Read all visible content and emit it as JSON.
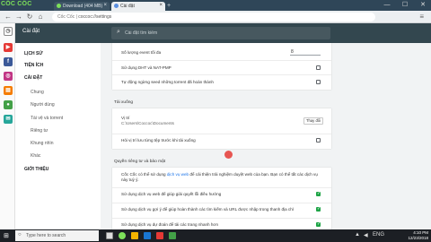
{
  "browser": {
    "logo_text": "CỐC CỐC",
    "tabs": [
      {
        "label": "Download (404 MB)",
        "active": false
      },
      {
        "label": "Cài đặt",
        "active": true
      }
    ],
    "new_tab_icon": "plus-icon",
    "address": {
      "prefix": "Cốc Cốc",
      "path": "coccoc://settings"
    }
  },
  "settings": {
    "title": "Cài đặt",
    "search_placeholder": "Cài đặt tìm kiếm"
  },
  "nav": {
    "items": [
      {
        "label": "LỊCH SỬ",
        "type": "section"
      },
      {
        "label": "TIỆN ÍCH",
        "type": "section"
      },
      {
        "label": "CÀI ĐẶT",
        "type": "section"
      },
      {
        "label": "Chung",
        "type": "sub"
      },
      {
        "label": "Người dùng",
        "type": "sub"
      },
      {
        "label": "Tài vệ và torrent",
        "type": "sub"
      },
      {
        "label": "Riêng tư",
        "type": "sub"
      },
      {
        "label": "Khung nhìn",
        "type": "sub"
      },
      {
        "label": "Khác",
        "type": "sub"
      },
      {
        "label": "GIỚI THIỆU",
        "type": "section"
      }
    ]
  },
  "content": {
    "card1": {
      "max_downloads": {
        "label": "Số lượng event tối đa",
        "value": "8"
      },
      "dht": {
        "label": "Sử dụng DHT và NAT-PMP",
        "checked": false
      },
      "seed_stop": {
        "label": "Tự động ngừng seed những torrent đã hoàn thành",
        "checked": false
      }
    },
    "downloads": {
      "title": "Tải xuống",
      "location_label": "Vị trí",
      "location_value": "C:\\Users\\Coccoc\\Documents",
      "change_button": "Thay đổi",
      "ask_label": "Hỏi vị trí lưu từng tệp trước khi tải xuống",
      "ask_checked": false
    },
    "privacy": {
      "title": "Quyền riêng tư và bảo mật",
      "desc": "Cốc Cốc có thể sử dụng",
      "desc_link": "dịch vụ web",
      "desc_tail": "để cải thiện trải nghiệm duyệt web của bạn. Bạn có thể tắt các dịch vụ này tuỳ ý.",
      "items": [
        {
          "label": "Sử dụng dịch vụ web để giúp giải quyết lỗi điều hướng",
          "checked": true
        },
        {
          "label": "Sử dụng dịch vụ gợi ý để giúp hoàn thành các tìm kiếm và URL được nhập trong thanh địa chỉ",
          "checked": true
        },
        {
          "label": "Sử dụng dịch vụ dự đoán để tải các trang nhanh hơn",
          "checked": true
        }
      ]
    }
  },
  "taskbar": {
    "search_placeholder": "Type here to search",
    "time": "4:10 PM",
    "date": "12/23/2018"
  },
  "colors": {
    "tabbar": "#2f4658",
    "header": "#33474f",
    "accent_green": "#1ea446",
    "link_blue": "#1a73e8"
  }
}
